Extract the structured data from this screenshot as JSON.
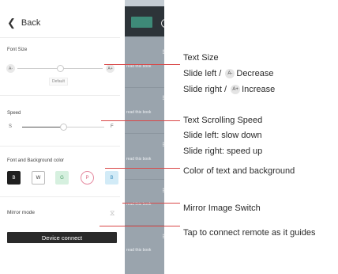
{
  "panel": {
    "back_label": "Back",
    "font_size": {
      "label": "Font Size",
      "min": "A-",
      "max": "A+",
      "default_label": "Default",
      "level": 0.5
    },
    "speed": {
      "label": "Speed",
      "min": "S",
      "max": "F",
      "level": 0.5
    },
    "colors": {
      "label": "Font and Background color",
      "options": [
        {
          "label": "B",
          "bg": "#1f1f1f",
          "fg": "#ffffff",
          "border": "#1f1f1f",
          "radius": "2px"
        },
        {
          "label": "W",
          "bg": "#ffffff",
          "fg": "#333333",
          "border": "#bbbbbb",
          "radius": "2px"
        },
        {
          "label": "G",
          "bg": "#d6f0df",
          "fg": "#4a9d66",
          "border": "#d6f0df",
          "radius": "2px"
        },
        {
          "label": "P",
          "bg": "#ffffff",
          "fg": "#d9637f",
          "border": "#e58aa0",
          "radius": "50%"
        },
        {
          "label": "B",
          "bg": "#d2ebf7",
          "fg": "#3e8fbd",
          "border": "#d2ebf7",
          "radius": "2px"
        }
      ]
    },
    "mirror": {
      "label": "Mirror mode",
      "icon": "hourglass-icon",
      "glyph": "⧖"
    },
    "connect_label": "Device connect"
  },
  "list": {
    "item_text": "read this book",
    "count": 5,
    "add_icon": "plus-circle-icon"
  },
  "callouts": {
    "text_size": {
      "title": "Text Size",
      "line2_prefix": "Slide left /",
      "line2_badge": "A-",
      "line2_suffix": "Decrease",
      "line3_prefix": "Slide right /",
      "line3_badge": "A+",
      "line3_suffix": "Increase"
    },
    "speed": {
      "title": "Text Scrolling Speed",
      "line2": "Slide left: slow down",
      "line3": "Slide right: speed up"
    },
    "color": {
      "title": "Color of text and background"
    },
    "mirror": {
      "title": "Mirror Image Switch"
    },
    "connect": {
      "title": "Tap to connect remote as it guides"
    }
  }
}
